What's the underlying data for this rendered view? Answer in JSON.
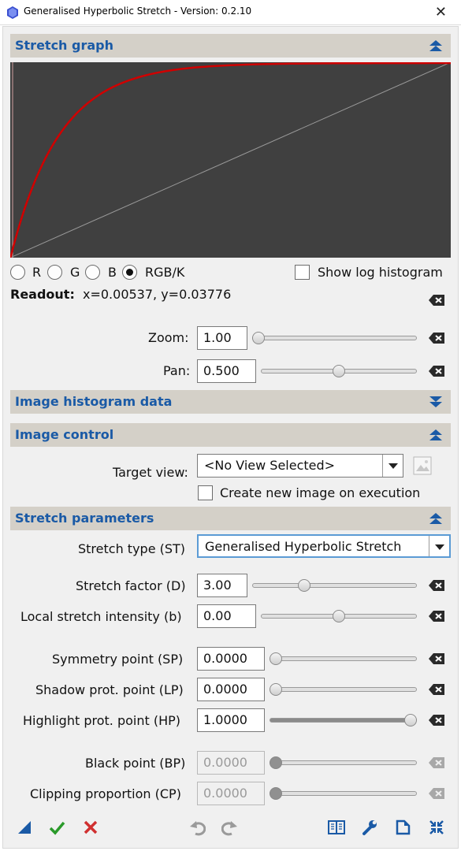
{
  "window": {
    "title": "Generalised Hyperbolic Stretch - Version: 0.2.10",
    "close_glyph": "✕"
  },
  "stretch_graph": {
    "section_title": "Stretch graph",
    "channels": [
      "R",
      "G",
      "B",
      "RGB/K"
    ],
    "selected_channel": "RGB/K",
    "show_log_histogram_label": "Show log histogram",
    "show_log_histogram_checked": false,
    "readout_label": "Readout:",
    "readout_value": "x=0.00537, y=0.03776",
    "zoom_label": "Zoom:",
    "zoom_value": "1.00",
    "zoom_slider": 0.0,
    "pan_label": "Pan:",
    "pan_value": "0.500",
    "pan_slider": 0.5,
    "curve_color": "#d00000",
    "background_color": "#404040"
  },
  "image_histogram": {
    "section_title": "Image histogram data",
    "collapsed": true
  },
  "image_control": {
    "section_title": "Image control",
    "target_view_label": "Target view:",
    "target_view_value": "<No View Selected>",
    "create_new_image_label": "Create new image on execution",
    "create_new_image_checked": false
  },
  "stretch_parameters": {
    "section_title": "Stretch parameters",
    "stretch_type_label": "Stretch type (ST)",
    "stretch_type_value": "Generalised Hyperbolic Stretch",
    "stretch_factor_label": "Stretch factor (D)",
    "stretch_factor_value": "3.00",
    "stretch_factor_slider": 0.3,
    "local_intensity_label": "Local stretch intensity (b)",
    "local_intensity_value": "0.00",
    "local_intensity_slider": 0.5,
    "symmetry_label": "Symmetry point (SP)",
    "symmetry_value": "0.0000",
    "symmetry_slider": 0.0,
    "shadow_label": "Shadow prot. point (LP)",
    "shadow_value": "0.0000",
    "shadow_slider": 0.0,
    "highlight_label": "Highlight prot. point (HP)",
    "highlight_value": "1.0000",
    "highlight_slider": 1.0,
    "black_point_label": "Black point (BP)",
    "black_point_value": "0.0000",
    "clipping_label": "Clipping proportion (CP)",
    "clipping_value": "0.0000"
  },
  "toolbar": {
    "icons": [
      "new-instance-icon",
      "apply-icon",
      "cancel-icon",
      "undo-icon",
      "redo-icon",
      "documentation-icon",
      "settings-icon",
      "reset-icon",
      "expand-icon"
    ],
    "apply_color": "#2a9a2a",
    "cancel_color": "#d03030",
    "accent_color": "#1a5aa6"
  }
}
